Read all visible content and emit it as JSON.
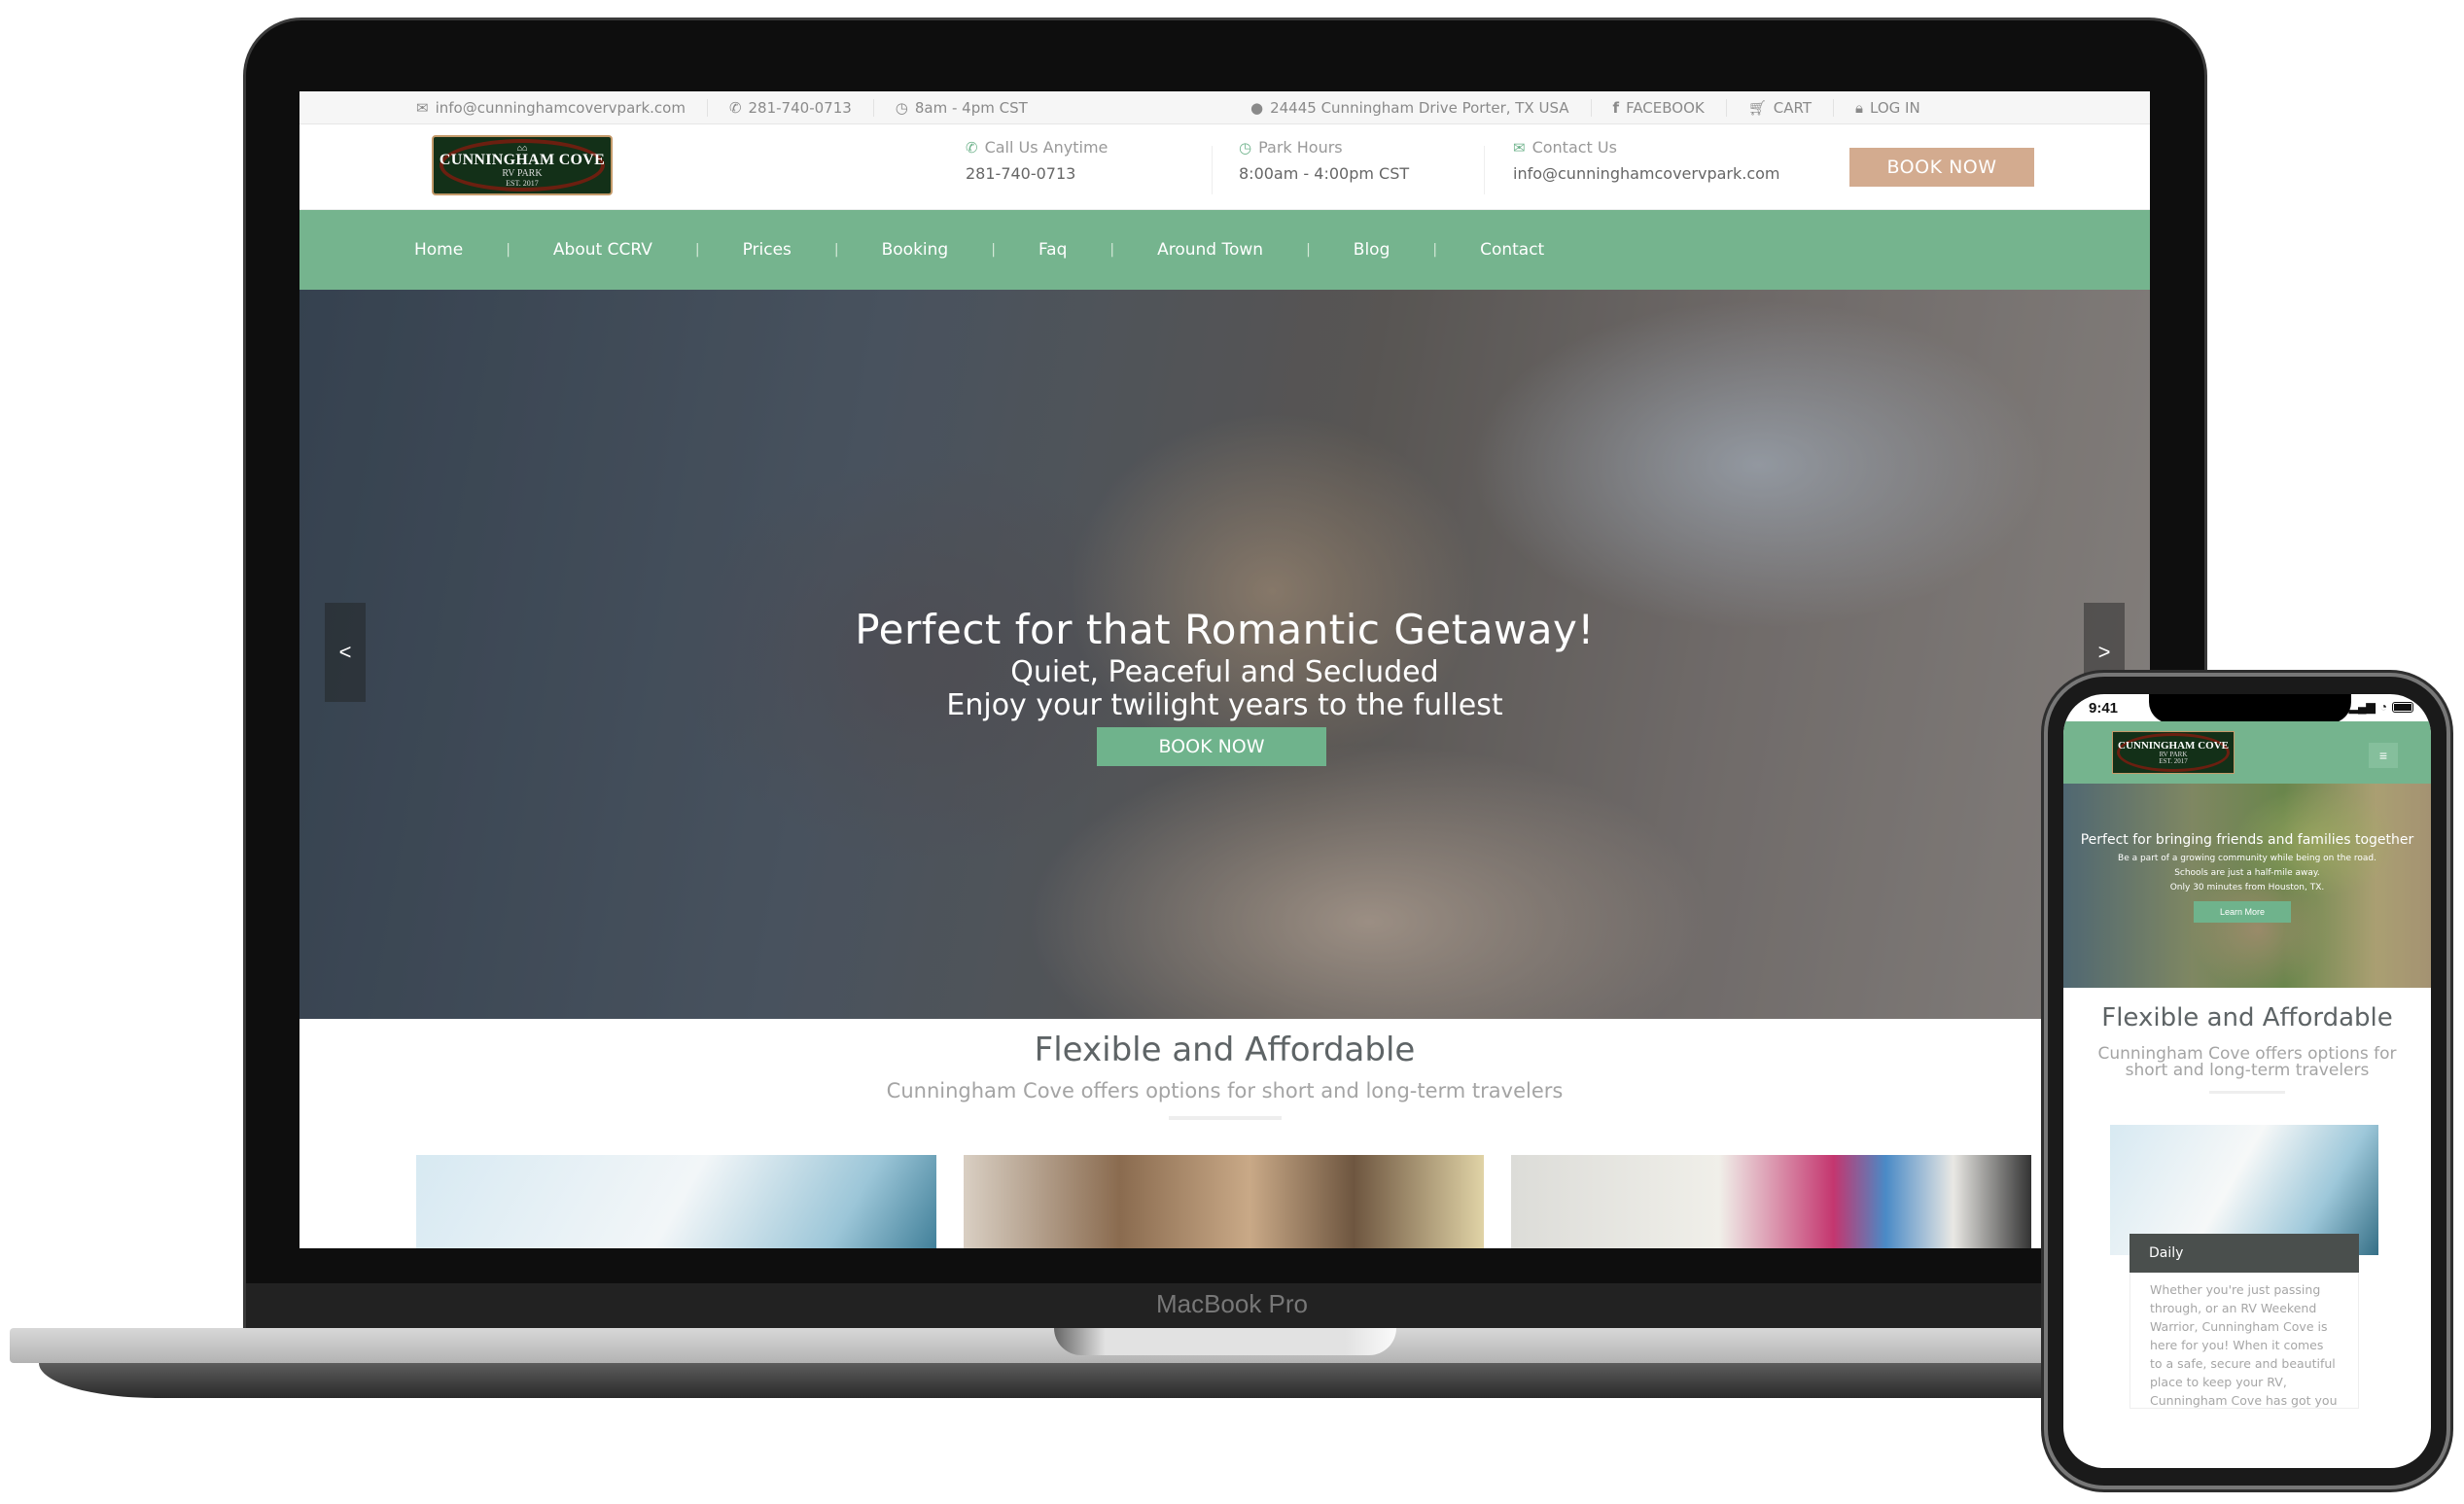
{
  "device": {
    "laptop_label": "MacBook Pro",
    "phone_time": "9:41"
  },
  "topbar": {
    "email": "info@cunninghamcovervpark.com",
    "phone": "281-740-0713",
    "hours": "8am - 4pm CST",
    "address": "24445 Cunningham Drive Porter, TX USA",
    "facebook": "FACEBOOK",
    "cart": "CART",
    "login": "LOG IN"
  },
  "logo": {
    "line1": "CUNNINGHAM COVE",
    "line2": "RV PARK",
    "line3": "EST. 2017"
  },
  "header": {
    "call_label": "Call Us Anytime",
    "call_value": "281-740-0713",
    "hours_label": "Park Hours",
    "hours_value": "8:00am - 4:00pm CST",
    "contact_label": "Contact Us",
    "contact_value": "info@cunninghamcovervpark.com",
    "book_now": "BOOK NOW"
  },
  "nav": {
    "items": [
      "Home",
      "About CCRV",
      "Prices",
      "Booking",
      "Faq",
      "Around Town",
      "Blog",
      "Contact"
    ],
    "separator": "|"
  },
  "hero": {
    "title": "Perfect for that Romantic Getaway!",
    "line2": "Quiet, Peaceful and Secluded",
    "line3": "Enjoy your twilight years to the fullest",
    "button": "BOOK NOW",
    "prev": "<",
    "next": ">"
  },
  "section": {
    "title": "Flexible and Affordable",
    "subtitle": "Cunningham Cove offers options for short and long-term travelers"
  },
  "mobile": {
    "hero_title": "Perfect for bringing friends and families together",
    "hero_l1": "Be a part of a growing community while being on the road.",
    "hero_l2": "Schools are just a half-mile away.",
    "hero_l3": "Only 30 minutes from Houston, TX.",
    "hero_button": "Learn More",
    "section_title": "Flexible and Affordable",
    "section_subtitle": "Cunningham Cove offers options for short and long-term travelers",
    "card_label": "Daily",
    "card_text": "Whether you're just passing through, or an RV Weekend Warrior, Cunningham Cove is here for you! When it comes to a safe, secure and beautiful place to keep your RV, Cunningham Cove has got you covered."
  },
  "colors": {
    "brand_green": "#75b48e",
    "accent_tan": "#d3ab8f",
    "card_label_bg": "#4a4f4d"
  }
}
